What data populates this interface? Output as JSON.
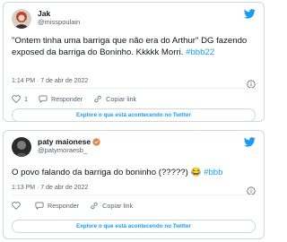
{
  "tweets": [
    {
      "display_name": "Jak",
      "handle": "@misspoulain",
      "verified": false,
      "text_plain": "\"Ontem tinha uma barriga que não era do Arthur\" DG fazendo exposed da barriga do Boninho. Kkkkk Morri.",
      "hashtag": "#bbb22",
      "timestamp": "1:14 PM · 7 de abr de 2022",
      "like_count": "1",
      "reply_label": "Responder",
      "copy_label": "Copiar link",
      "explore_label": "Explore o que está acontecendo no Twitter"
    },
    {
      "display_name": "paty maionese",
      "handle": "@patymoraesb_",
      "verified": true,
      "text_plain": "O povo falando da barriga do boninho (?????) 😂",
      "hashtag": "#bbb",
      "timestamp": "1:13 PM · 7 de abr de 2022",
      "like_count": "",
      "reply_label": "Responder",
      "copy_label": "Copiar link",
      "explore_label": "Explore o que está acontecendo no Twitter"
    }
  ],
  "icons": {
    "brand": "twitter-bird-icon",
    "info": "info-icon",
    "like": "heart-icon",
    "reply": "speech-bubble-icon",
    "copy": "link-icon",
    "verified": "verified-badge-icon"
  },
  "colors": {
    "accent": "#1d9bf0",
    "verified_badge": "#e0854a",
    "border": "#cfd9de",
    "secondary_text": "#536471"
  }
}
